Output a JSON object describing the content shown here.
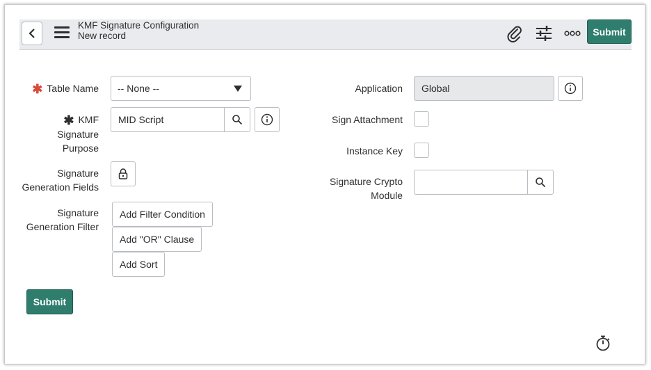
{
  "header": {
    "title": "KMF Signature Configuration",
    "subtitle": "New record",
    "back_icon": "chevron-left-icon",
    "menu_icon": "hamburger-icon",
    "attachment_icon": "paperclip-icon",
    "settings_icon": "sliders-icon",
    "more_icon": "more-options-icon",
    "submit_label": "Submit"
  },
  "form": {
    "table_name": {
      "label": "Table Name",
      "required": true,
      "value": "-- None --"
    },
    "purpose": {
      "label_line1": "KMF",
      "label_line2": "Signature",
      "label_line3": "Purpose",
      "value": "MID Script"
    },
    "generation_fields": {
      "label_line1": "Signature",
      "label_line2": "Generation Fields",
      "icon": "lock-icon"
    },
    "generation_filter": {
      "label_line1": "Signature",
      "label_line2": "Generation Filter",
      "add_filter_label": "Add Filter Condition",
      "add_or_label": "Add \"OR\" Clause",
      "add_sort_label": "Add Sort"
    },
    "application": {
      "label": "Application",
      "value": "Global"
    },
    "sign_attachment": {
      "label": "Sign Attachment",
      "checked": false
    },
    "instance_key": {
      "label": "Instance Key",
      "checked": false
    },
    "crypto_module": {
      "label_line1": "Signature Crypto",
      "label_line2": "Module",
      "value": ""
    },
    "submit_label": "Submit"
  },
  "footer": {
    "timer_icon": "stopwatch-icon"
  },
  "colors": {
    "primary": "#2e7d6d",
    "required": "#d94a3d",
    "header_bg": "#e9ebee"
  }
}
